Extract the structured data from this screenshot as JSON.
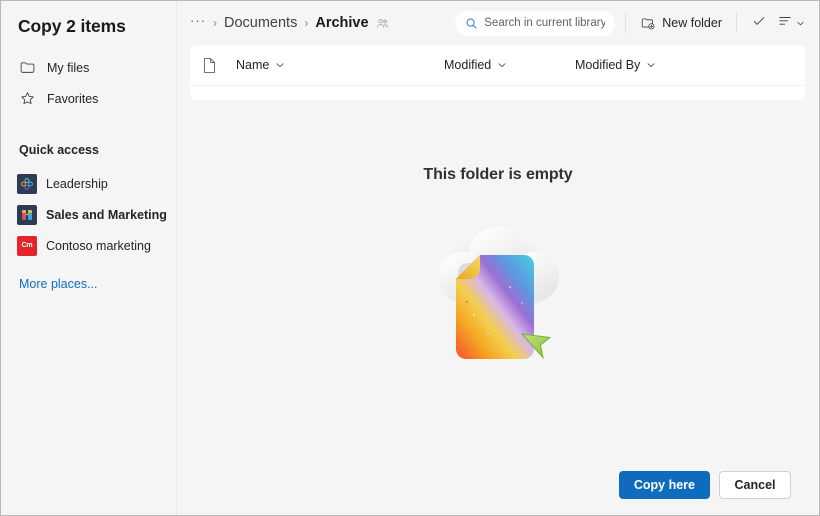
{
  "dialog": {
    "title": "Copy 2 items"
  },
  "sidebar": {
    "nav": [
      {
        "label": "My files",
        "icon": "folder-icon"
      },
      {
        "label": "Favorites",
        "icon": "star-icon"
      }
    ],
    "quick_access_header": "Quick access",
    "quick_access": [
      {
        "label": "Leadership",
        "icon": "sharepoint-site-icon",
        "selected": false,
        "badge": ""
      },
      {
        "label": "Sales and Marketing",
        "icon": "sharepoint-site-icon",
        "selected": true,
        "badge": ""
      },
      {
        "label": "Contoso marketing",
        "icon": "contoso-marketing-icon",
        "selected": false,
        "badge": "Cm"
      }
    ],
    "more_places_label": "More places..."
  },
  "commandbar": {
    "breadcrumb": {
      "overflow": "···",
      "separator": "›",
      "items": [
        {
          "label": "Documents",
          "current": false
        },
        {
          "label": "Archive",
          "current": true
        }
      ]
    },
    "search": {
      "placeholder": "Search in current library",
      "value": ""
    },
    "new_folder_label": "New folder",
    "check_icon_name": "checkmark-icon",
    "sort_icon_name": "sort-list-icon"
  },
  "file_list": {
    "columns": [
      {
        "label": "Name"
      },
      {
        "label": "Modified"
      },
      {
        "label": "Modified By"
      }
    ],
    "rows": []
  },
  "empty_state": {
    "title": "This folder is empty",
    "illustration": "cloud-with-document-illustration"
  },
  "footer": {
    "primary_label": "Copy here",
    "secondary_label": "Cancel"
  },
  "colors": {
    "accent": "#0f6cbd",
    "link": "#0f6cbd",
    "page_bg": "#f5f5f5",
    "card_bg": "#ffffff",
    "text": "#242424",
    "contoso_red": "#e3242b",
    "sharepoint_navy": "#2f3b52"
  }
}
